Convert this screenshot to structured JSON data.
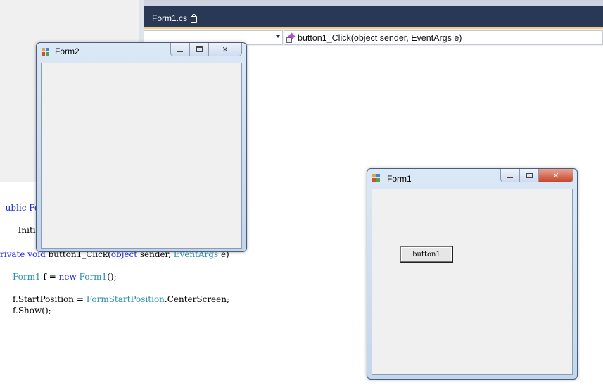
{
  "editor": {
    "tab_label": "Form1.cs",
    "method_dropdown": "button1_Click(object sender, EventArgs e)"
  },
  "code": {
    "l1a": "ublic Fo",
    "l2a": "Initi",
    "l3_kw1": "rivate void ",
    "l3_name": "button1_Click(",
    "l3_kw2": "object",
    "l3_mid": " sender, ",
    "l3_ty": "EventArgs",
    "l3_end": " e)",
    "l4_ty": "Form1",
    "l4_mid": " f = ",
    "l4_kw": "new",
    "l4_sp": " ",
    "l4_ty2": "Form1",
    "l4_end": "();",
    "l5_pre": "f.StartPosition = ",
    "l5_ty": "FormStartPosition",
    "l5_end": ".CenterScreen;",
    "l6": "f.Show();"
  },
  "form2": {
    "title": "Form2"
  },
  "form1": {
    "title": "Form1",
    "button_label": "button1"
  },
  "colors": {
    "tabstrip": "#293955",
    "keyword": "#1f2bd6",
    "type": "#2b91af",
    "close": "#c9452b"
  }
}
